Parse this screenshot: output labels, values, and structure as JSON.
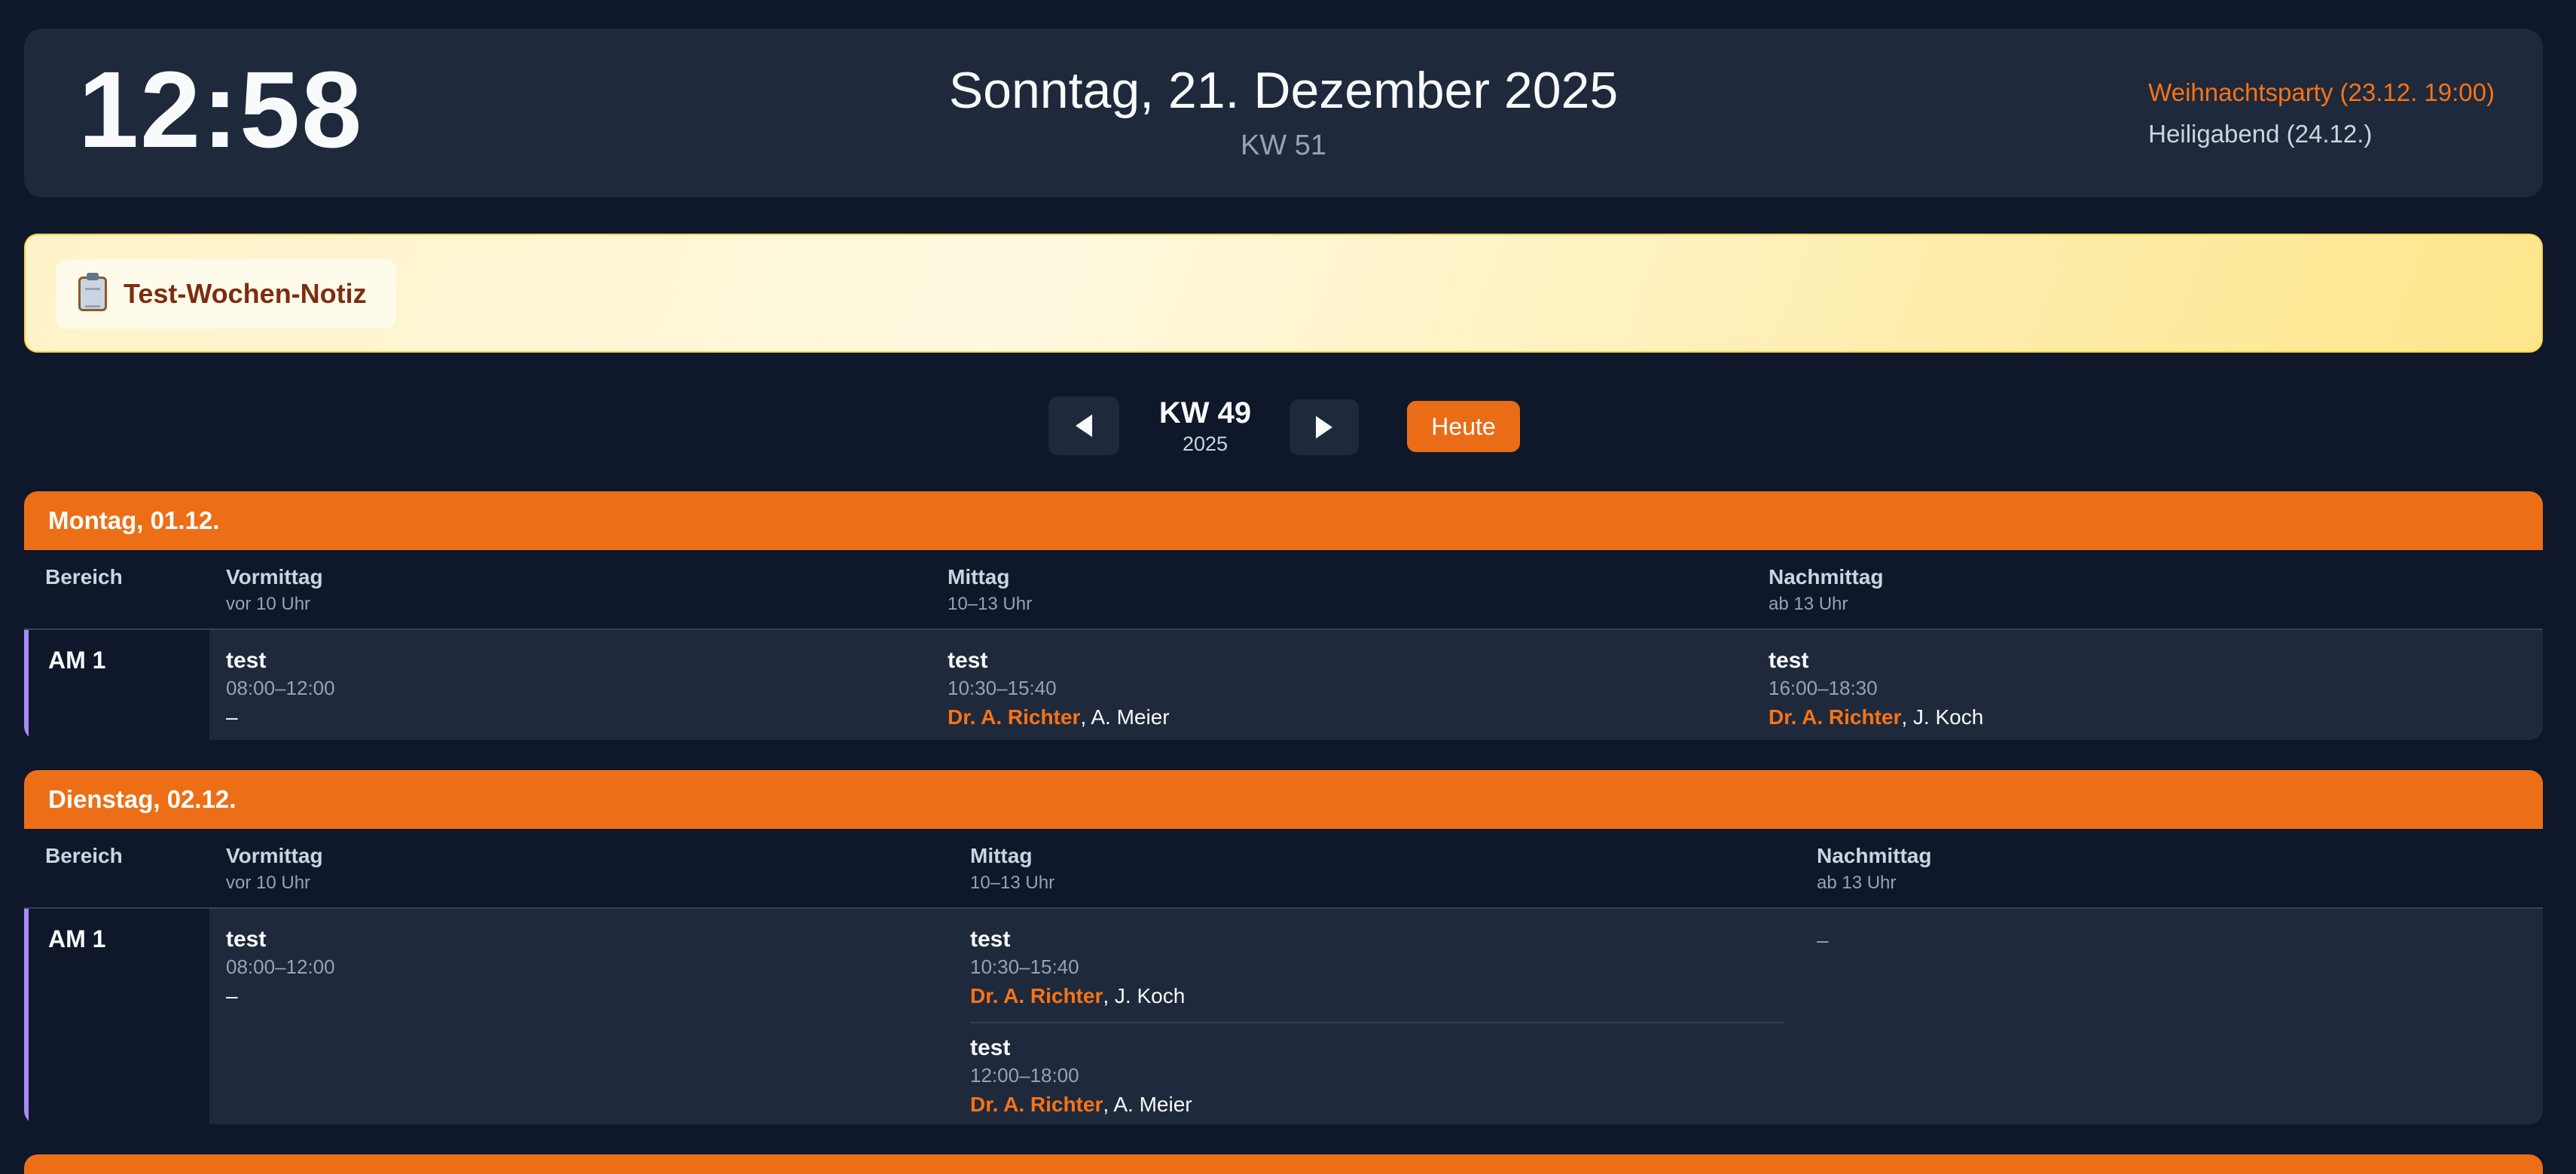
{
  "header": {
    "clock": "12:58",
    "date": "Sonntag, 21. Dezember 2025",
    "kw": "KW 51",
    "events": [
      {
        "label": "Weihnachtsparty (23.12. 19:00)",
        "highlight": true,
        "color": "#f97316"
      },
      {
        "label": "Heiligabend (24.12.)",
        "highlight": false
      }
    ]
  },
  "note": {
    "icon": "clipboard-icon",
    "text": "Test-Wochen-Notiz"
  },
  "weeknav": {
    "prev_icon": "chevron-left-icon",
    "next_icon": "chevron-right-icon",
    "week": "KW 49",
    "year": "2025",
    "today_label": "Heute"
  },
  "columns": {
    "area": "Bereich",
    "morning": {
      "title": "Vormittag",
      "sub": "vor 10 Uhr"
    },
    "noon": {
      "title": "Mittag",
      "sub": "10–13 Uhr"
    },
    "afternoon": {
      "title": "Nachmittag",
      "sub": "ab 13 Uhr"
    }
  },
  "days": [
    {
      "title": "Montag, 01.12.",
      "area": "AM 1",
      "morning": {
        "title": "test",
        "time": "08:00–12:00",
        "staff_text": "–"
      },
      "noon": {
        "title": "test",
        "time": "10:30–15:40",
        "lead": "Dr. A. Richter",
        "rest": ", A. Meier"
      },
      "afternoon": {
        "title": "test",
        "time": "16:00–18:30",
        "lead": "Dr. A. Richter",
        "rest": ", J. Koch"
      }
    },
    {
      "title": "Dienstag, 02.12.",
      "area": "AM 1",
      "morning": {
        "title": "test",
        "time": "08:00–12:00",
        "staff_text": "–"
      },
      "noon": [
        {
          "title": "test",
          "time": "10:30–15:40",
          "lead": "Dr. A. Richter",
          "rest": ", J. Koch"
        },
        {
          "title": "test",
          "time": "12:00–18:00",
          "lead": "Dr. A. Richter",
          "rest": ", A. Meier"
        }
      ],
      "afternoon_empty": "–"
    }
  ],
  "colors": {
    "accent": "#ec6f17",
    "background": "#0f172a",
    "card": "#1e293b",
    "row_marker": "#a78bfa"
  }
}
